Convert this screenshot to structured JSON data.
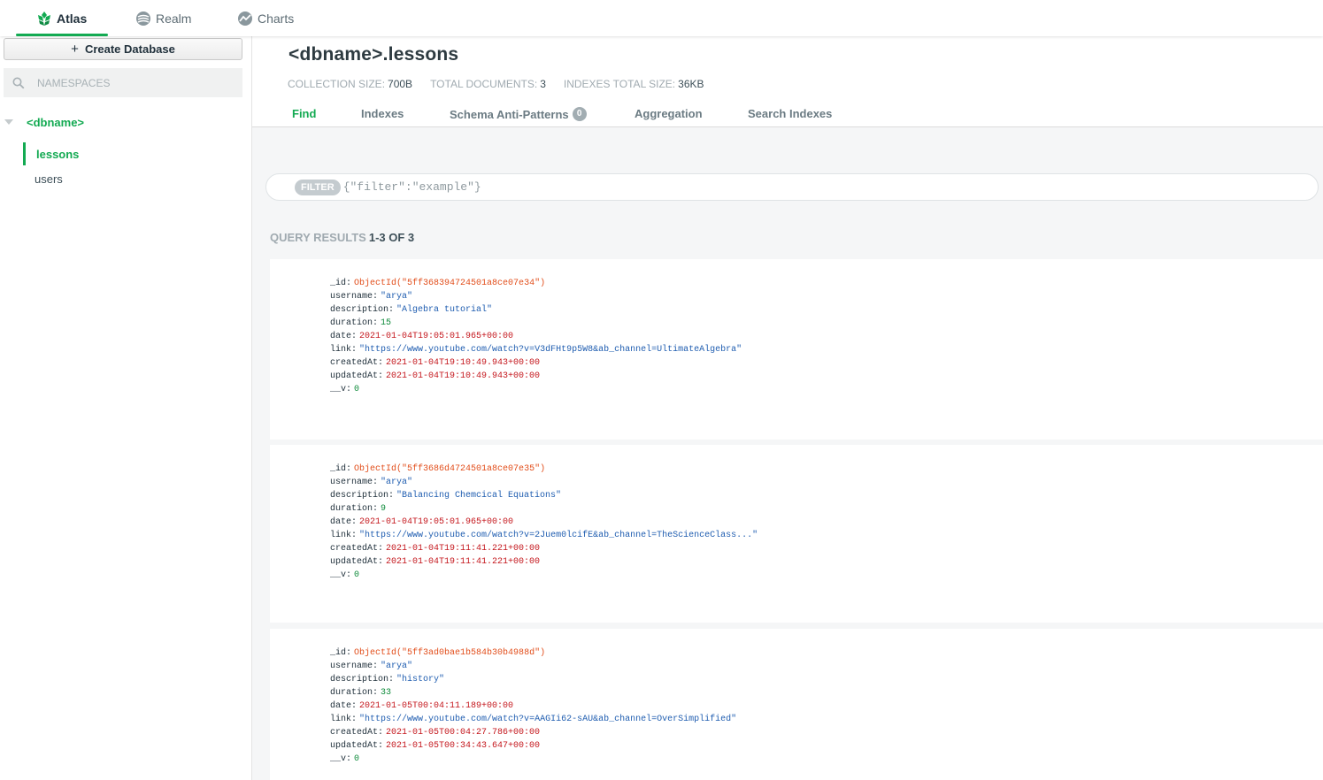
{
  "topnav": {
    "tabs": [
      {
        "label": "Atlas",
        "icon": "atlas-leaf-icon",
        "active": true
      },
      {
        "label": "Realm",
        "icon": "realm-icon",
        "active": false
      },
      {
        "label": "Charts",
        "icon": "charts-icon",
        "active": false
      }
    ]
  },
  "sidebar": {
    "create_label": "Create Database",
    "create_icon": "plus-icon",
    "search_placeholder": "NAMESPACES",
    "search_icon": "search-icon",
    "database": "<dbname>",
    "collections": [
      {
        "label": "lessons",
        "active": true
      },
      {
        "label": "users",
        "active": false
      }
    ]
  },
  "main": {
    "title": "<dbname>.lessons",
    "stats": [
      {
        "key": "COLLECTION SIZE:",
        "value": "700B"
      },
      {
        "key": "TOTAL DOCUMENTS:",
        "value": "3"
      },
      {
        "key": "INDEXES TOTAL SIZE:",
        "value": "36KB"
      }
    ],
    "tabs": [
      {
        "label": "Find",
        "active": true
      },
      {
        "label": "Indexes",
        "active": false
      },
      {
        "label": "Schema Anti-Patterns",
        "badge": "0",
        "active": false
      },
      {
        "label": "Aggregation",
        "active": false
      },
      {
        "label": "Search Indexes",
        "active": false
      }
    ],
    "filter_label": "FILTER",
    "filter_placeholder": "{\"filter\":\"example\"}",
    "results_key": "QUERY RESULTS",
    "results_value": "1-3 OF 3"
  },
  "documents": [
    {
      "fields": [
        {
          "key": "_id",
          "value": "ObjectId(\"5ff368394724501a8ce07e34\")",
          "type": "oid"
        },
        {
          "key": "username",
          "value": "\"arya\"",
          "type": "str"
        },
        {
          "key": "description",
          "value": "\"Algebra tutorial\"",
          "type": "str"
        },
        {
          "key": "duration",
          "value": "15",
          "type": "num"
        },
        {
          "key": "date",
          "value": "2021-01-04T19:05:01.965+00:00",
          "type": "date"
        },
        {
          "key": "link",
          "value": "\"https://www.youtube.com/watch?v=V3dFHt9p5W8&ab_channel=UltimateAlgebra\"",
          "type": "str"
        },
        {
          "key": "createdAt",
          "value": "2021-01-04T19:10:49.943+00:00",
          "type": "date"
        },
        {
          "key": "updatedAt",
          "value": "2021-01-04T19:10:49.943+00:00",
          "type": "date"
        },
        {
          "key": "__v",
          "value": "0",
          "type": "num"
        }
      ]
    },
    {
      "fields": [
        {
          "key": "_id",
          "value": "ObjectId(\"5ff3686d4724501a8ce07e35\")",
          "type": "oid"
        },
        {
          "key": "username",
          "value": "\"arya\"",
          "type": "str"
        },
        {
          "key": "description",
          "value": "\"Balancing Chemcical Equations\"",
          "type": "str"
        },
        {
          "key": "duration",
          "value": "9",
          "type": "num"
        },
        {
          "key": "date",
          "value": "2021-01-04T19:05:01.965+00:00",
          "type": "date"
        },
        {
          "key": "link",
          "value": "\"https://www.youtube.com/watch?v=2Juem0lcifE&ab_channel=TheScienceClass...\"",
          "type": "str"
        },
        {
          "key": "createdAt",
          "value": "2021-01-04T19:11:41.221+00:00",
          "type": "date"
        },
        {
          "key": "updatedAt",
          "value": "2021-01-04T19:11:41.221+00:00",
          "type": "date"
        },
        {
          "key": "__v",
          "value": "0",
          "type": "num"
        }
      ]
    },
    {
      "fields": [
        {
          "key": "_id",
          "value": "ObjectId(\"5ff3ad0bae1b584b30b4988d\")",
          "type": "oid"
        },
        {
          "key": "username",
          "value": "\"arya\"",
          "type": "str"
        },
        {
          "key": "description",
          "value": "\"history\"",
          "type": "str"
        },
        {
          "key": "duration",
          "value": "33",
          "type": "num"
        },
        {
          "key": "date",
          "value": "2021-01-05T00:04:11.189+00:00",
          "type": "date"
        },
        {
          "key": "link",
          "value": "\"https://www.youtube.com/watch?v=AAGIi62-sAU&ab_channel=OverSimplified\"",
          "type": "str"
        },
        {
          "key": "createdAt",
          "value": "2021-01-05T00:04:27.786+00:00",
          "type": "date"
        },
        {
          "key": "updatedAt",
          "value": "2021-01-05T00:34:43.647+00:00",
          "type": "date"
        },
        {
          "key": "__v",
          "value": "0",
          "type": "num"
        }
      ]
    }
  ],
  "colors": {
    "accent": "#13aa52",
    "oid": "#e24e1b",
    "string": "#1f5db0",
    "number": "#0f8b3b",
    "date": "#c4161c"
  }
}
